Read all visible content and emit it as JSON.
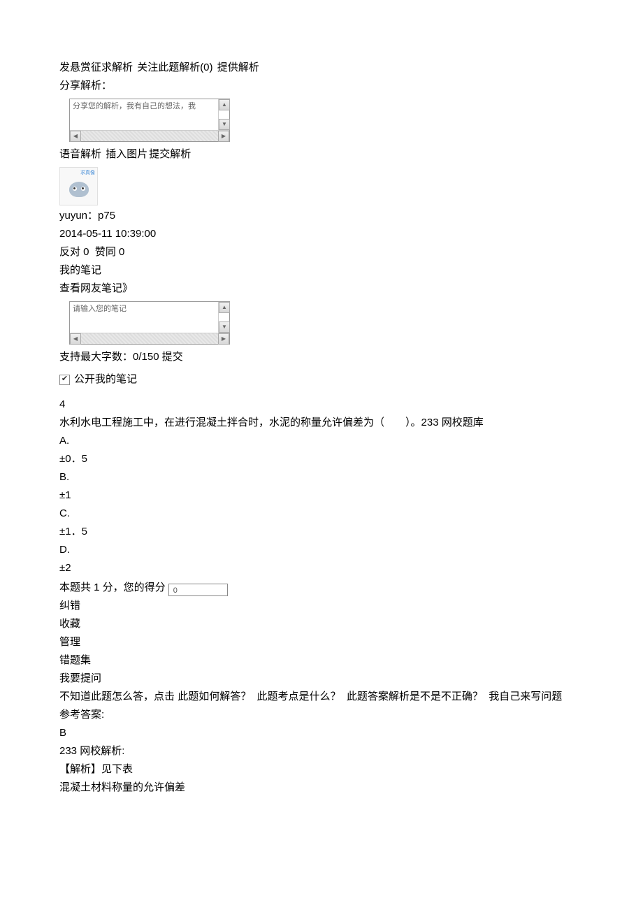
{
  "actions1": {
    "bounty": "发悬赏征求解析",
    "follow": "关注此题解析(0)",
    "provide": "提供解析"
  },
  "share_label": "分享解析：",
  "share_placeholder": "分享您的解析，我有自己的想法，我",
  "voice_label": "语音解析",
  "insert_image": "插入图片",
  "submit_analysis": "提交解析",
  "avatar_tag": "求真像",
  "comment": {
    "user": "yuyun：",
    "text": "p75",
    "time": "2014-05-11 10:39:00",
    "oppose": "反对 0",
    "agree": "赞同 0"
  },
  "notes": {
    "my_notes": "我的笔记",
    "view_friends": "查看网友笔记》",
    "placeholder": "请输入您的笔记",
    "limit_prefix": "支持最大字数：",
    "limit_count": "0/150",
    "submit": "提交",
    "public_label": "公开我的笔记"
  },
  "question": {
    "number": "4",
    "stem": "水利水电工程施工中，在进行混凝土拌合时，水泥的称量允许偏差为（　　）。233 网校题库",
    "opt_a_label": "A.",
    "opt_a_text": "±0．5",
    "opt_b_label": "B.",
    "opt_b_text": "±1",
    "opt_c_label": "C.",
    "opt_c_text": "±1．5",
    "opt_d_label": "D.",
    "opt_d_text": "±2",
    "score_prefix": "本题共 1 分，您的得分",
    "score_value": "0"
  },
  "tools": {
    "correct": "纠错",
    "favorite": "收藏",
    "manage": "管理",
    "wrong_set": "错题集",
    "ask": "我要提问"
  },
  "help_line": {
    "prefix": "不知道此题怎么答，点击",
    "q1": "此题如何解答？",
    "q2": "此题考点是什么？",
    "q3": "此题答案解析是不是不正确？",
    "q4": "我自己来写问题"
  },
  "answer": {
    "ref_label": "参考答案:",
    "ref_value": "B",
    "analysis_label": "233 网校解析:",
    "analysis_text": "【解析】见下表",
    "table_title": "混凝土材料称量的允许偏差"
  }
}
